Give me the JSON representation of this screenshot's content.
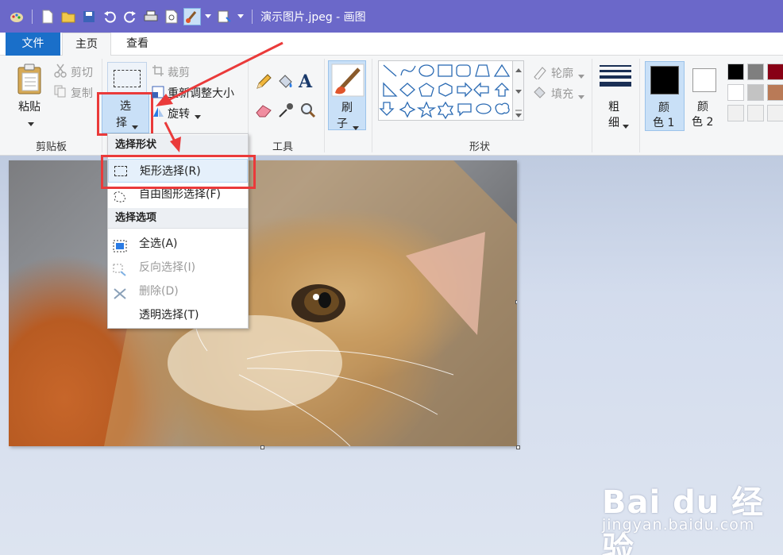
{
  "window": {
    "title": "演示图片.jpeg - 画图"
  },
  "tabs": [
    {
      "label": "文件"
    },
    {
      "label": "主页"
    },
    {
      "label": "查看"
    }
  ],
  "ribbon": {
    "clipboard": {
      "paste_label": "粘贴",
      "cut_label": "剪切",
      "copy_label": "复制",
      "group_label": "剪贴板"
    },
    "image": {
      "select_label_1": "选",
      "select_label_2": "择",
      "crop_label": "裁剪",
      "resize_label": "重新调整大小",
      "rotate_label": "旋转"
    },
    "tools": {
      "group_label": "工具"
    },
    "brush": {
      "label_1": "刷",
      "label_2": "子"
    },
    "shapes": {
      "outline_label": "轮廓",
      "fill_label": "填充",
      "group_label": "形状"
    },
    "size": {
      "label_1": "粗",
      "label_2": "细"
    },
    "color1": {
      "label_1": "颜",
      "label_2": "色 1",
      "color": "#000000"
    },
    "color2": {
      "label_1": "颜",
      "label_2": "色 2",
      "color": "#ffffff"
    },
    "palette": [
      "#000000",
      "#7f7f7f",
      "#880015",
      "#ffffff",
      "#c3c3c3",
      "#b97a57"
    ]
  },
  "select_menu": {
    "header_shapes": "选择形状",
    "rect_select": "矩形选择(R)",
    "free_select": "自由图形选择(F)",
    "header_options": "选择选项",
    "select_all": "全选(A)",
    "invert_select": "反向选择(I)",
    "delete": "删除(D)",
    "transparent_select": "透明选择(T)"
  },
  "watermark": {
    "logo": "Bai du 经验",
    "url": "jingyan.baidu.com"
  },
  "colors": {
    "titlebar": "#6b68c9",
    "file_tab": "#1a6fc9",
    "highlight_red": "#ea3a3a"
  }
}
